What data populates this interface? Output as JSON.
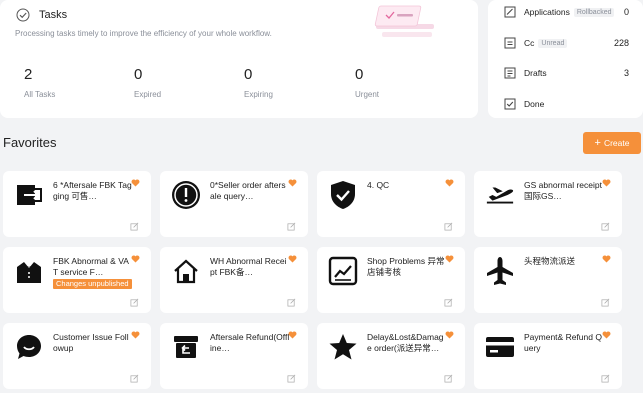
{
  "tasks": {
    "title": "Tasks",
    "subtitle": "Processing tasks timely to improve the efficiency of your whole workflow.",
    "stats": [
      {
        "value": "2",
        "label": "All Tasks"
      },
      {
        "value": "0",
        "label": "Expired"
      },
      {
        "value": "0",
        "label": "Expiring"
      },
      {
        "value": "0",
        "label": "Urgent"
      }
    ]
  },
  "side": {
    "items": [
      {
        "label": "Applications",
        "badge": "Rollbacked",
        "count": "0",
        "icon": "applications-icon"
      },
      {
        "label": "Cc",
        "badge": "Unread",
        "count": "228",
        "icon": "cc-icon"
      },
      {
        "label": "Drafts",
        "badge": "",
        "count": "3",
        "icon": "drafts-icon"
      },
      {
        "label": "Done",
        "badge": "",
        "count": "",
        "icon": "done-icon"
      }
    ]
  },
  "favorites": {
    "title": "Favorites",
    "create_label": "Create",
    "accent": "#f5903a",
    "items": [
      {
        "name": "6 *Aftersale FBK Tagging 可售…",
        "icon": "exit-icon"
      },
      {
        "name": "0*Seller order aftersale query…",
        "icon": "alert-circle-icon"
      },
      {
        "name": "4. QC",
        "icon": "shield-check-icon"
      },
      {
        "name": "GS abnormal receipt 国际GS…",
        "icon": "airplane-takeoff-icon"
      },
      {
        "name": "FBK Abnormal & VAT service F…",
        "icon": "tuxedo-icon",
        "tag": "Changes unpublished"
      },
      {
        "name": "WH Abnormal Receipt FBK备…",
        "icon": "home-icon"
      },
      {
        "name": "Shop Problems 异常店铺考核",
        "icon": "chart-up-icon"
      },
      {
        "name": "头程物流派送",
        "icon": "airplane-icon"
      },
      {
        "name": "Customer Issue Followup",
        "icon": "chat-bubble-icon"
      },
      {
        "name": "Aftersale Refund(Offline…",
        "icon": "refund-box-icon"
      },
      {
        "name": "Delay&Lost&Damage order(派送异常…",
        "icon": "star-icon"
      },
      {
        "name": "Payment& Refund Query",
        "icon": "credit-card-icon"
      }
    ]
  }
}
